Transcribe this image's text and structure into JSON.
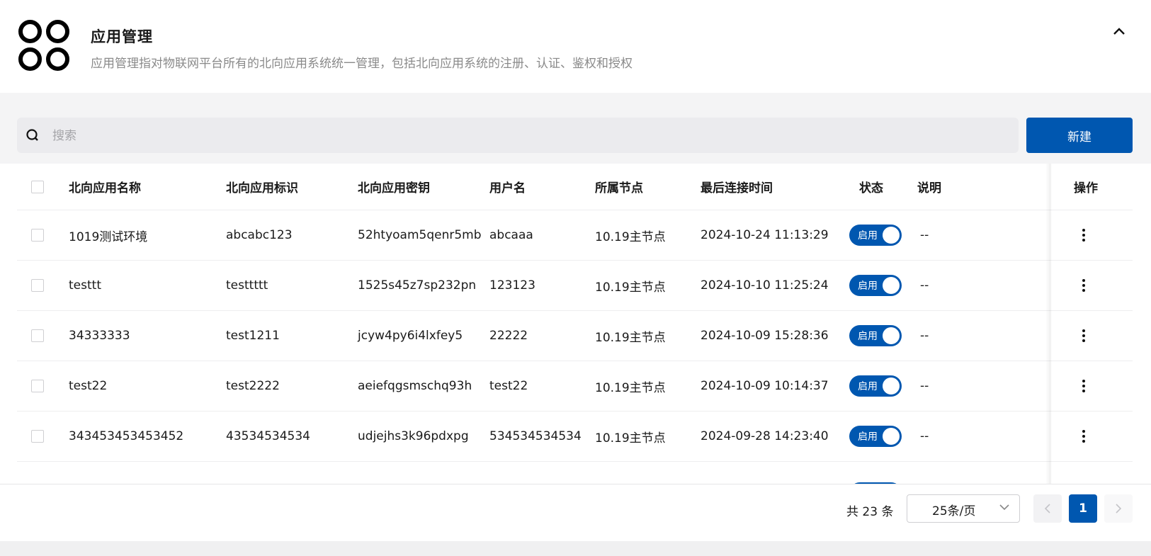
{
  "header": {
    "title": "应用管理",
    "subtitle": "应用管理指对物联网平台所有的北向应用系统统一管理，包括北向应用系统的注册、认证、鉴权和授权"
  },
  "toolbar": {
    "search_placeholder": "搜索",
    "new_label": "新建"
  },
  "table": {
    "columns": [
      "北向应用名称",
      "北向应用标识",
      "北向应用密钥",
      "用户名",
      "所属节点",
      "最后连接时间",
      "状态",
      "说明",
      "操作"
    ],
    "rows": [
      {
        "name": "1019测试环境",
        "id": "abcabc123",
        "secret": "52htyoam5qenr5mb",
        "user": "abcaaa",
        "node": "10.19主节点",
        "time": "2024-10-24 11:13:29",
        "status": "启用",
        "desc": "--"
      },
      {
        "name": "testtt",
        "id": "testtttt",
        "secret": "1525s45z7sp232pn",
        "user": "123123",
        "node": "10.19主节点",
        "time": "2024-10-10 11:25:24",
        "status": "启用",
        "desc": "--"
      },
      {
        "name": "34333333",
        "id": "test1211",
        "secret": "jcyw4py6i4lxfey5",
        "user": "22222",
        "node": "10.19主节点",
        "time": "2024-10-09 15:28:36",
        "status": "启用",
        "desc": "--"
      },
      {
        "name": "test22",
        "id": "test2222",
        "secret": "aeiefqgsmschq93h",
        "user": "test22",
        "node": "10.19主节点",
        "time": "2024-10-09 10:14:37",
        "status": "启用",
        "desc": "--"
      },
      {
        "name": "343453453453452",
        "id": "43534534534",
        "secret": "udjejhs3k96pdxpg",
        "user": "534534534534",
        "node": "10.19主节点",
        "time": "2024-09-28 14:23:40",
        "status": "启用",
        "desc": "--"
      }
    ]
  },
  "pager": {
    "total": "共 23 条",
    "page_size": "25条/页",
    "current_page": "1"
  },
  "colors": {
    "primary": "#0057b0"
  }
}
